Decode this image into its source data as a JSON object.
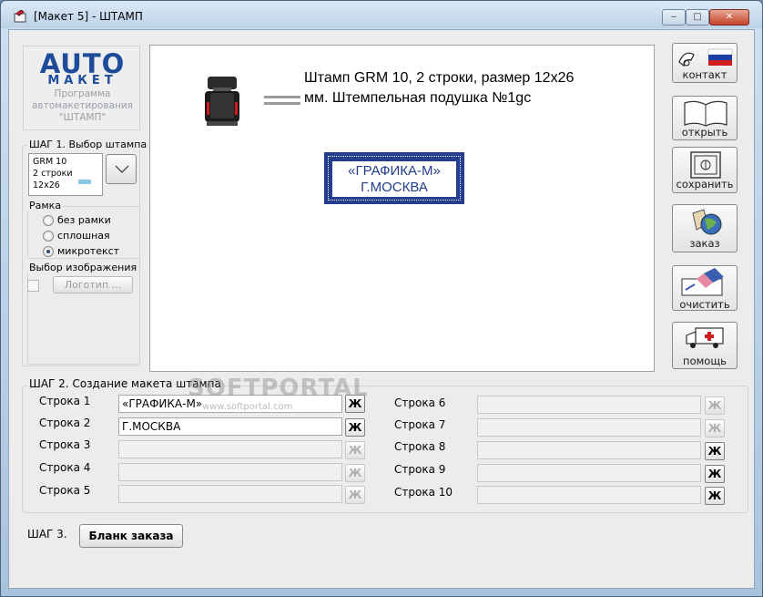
{
  "window": {
    "title": "[Макет 5] - ШТАМП",
    "minimize": "‒",
    "maximize": "□",
    "close": "✕"
  },
  "logo": {
    "auto": "AUTO",
    "maket": "МАКЕТ",
    "line1": "Программа",
    "line2": "автомакетирования",
    "line3": "\"ШТАМП\""
  },
  "step1": {
    "label": "ШАГ 1. Выбор штампа",
    "selected_lines": [
      "GRM 10",
      "2 строки",
      "12x26"
    ],
    "frame_label": "Рамка",
    "frame_options": [
      "без рамки",
      "сплошная",
      "микротекст"
    ],
    "frame_selected": "микротекст",
    "image_label": "Выбор изображения",
    "logo_button": "Логотип ..."
  },
  "preview": {
    "description_line1": "Штамп GRM 10, 2 строки, размер 12х26",
    "description_line2": "мм. Штемпельная подушка №1gc",
    "stamp_line1": "«ГРАФИКА-М»",
    "stamp_line2": "Г.МОСКВА"
  },
  "side_buttons": {
    "contact": "контакт",
    "open": "открыть",
    "save": "сохранить",
    "order": "заказ",
    "clear": "очистить",
    "help": "помощь"
  },
  "step2": {
    "label": "ШАГ 2. Создание макета штампа",
    "bold_glyph": "Ж",
    "left_rows": [
      {
        "label": "Строка 1",
        "value": "«ГРАФИКА-М»",
        "enabled": true
      },
      {
        "label": "Строка 2",
        "value": "Г.МОСКВА",
        "enabled": true
      },
      {
        "label": "Строка 3",
        "value": "",
        "enabled": false
      },
      {
        "label": "Строка 4",
        "value": "",
        "enabled": false
      },
      {
        "label": "Строка 5",
        "value": "",
        "enabled": false
      }
    ],
    "right_rows": [
      {
        "label": "Строка 6",
        "value": "",
        "enabled": false
      },
      {
        "label": "Строка 7",
        "value": "",
        "enabled": false
      },
      {
        "label": "Строка 8",
        "value": "",
        "enabled": false
      },
      {
        "label": "Строка 9",
        "value": "",
        "enabled": false
      },
      {
        "label": "Строка 10",
        "value": "",
        "enabled": false
      }
    ]
  },
  "step3": {
    "label": "ШАГ 3.",
    "order_form_button": "Бланк заказа"
  },
  "watermark": {
    "main": "SOFTPORTAL",
    "sub": "www.softportal.com"
  }
}
